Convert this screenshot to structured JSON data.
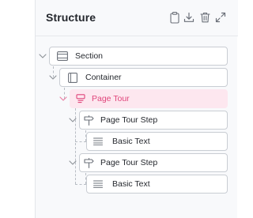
{
  "panel": {
    "title": "Structure",
    "actions": [
      "copy-icon",
      "download-icon",
      "delete-icon",
      "expand-icon"
    ]
  },
  "tree": {
    "section": {
      "label": "Section",
      "icon": "section-icon"
    },
    "container": {
      "label": "Container",
      "icon": "container-icon"
    },
    "page_tour": {
      "label": "Page Tour",
      "icon": "page-tour-icon",
      "selected": true
    },
    "steps": [
      {
        "label": "Page Tour Step",
        "icon": "signpost-icon",
        "child": {
          "label": "Basic Text",
          "icon": "text-lines-icon"
        }
      },
      {
        "label": "Page Tour Step",
        "icon": "signpost-icon",
        "child": {
          "label": "Basic Text",
          "icon": "text-lines-icon"
        }
      }
    ]
  },
  "colors": {
    "accent": "#e0457b",
    "selected_bg": "#fde7ef",
    "border": "#c9cdd3",
    "icon": "#6b7079"
  }
}
